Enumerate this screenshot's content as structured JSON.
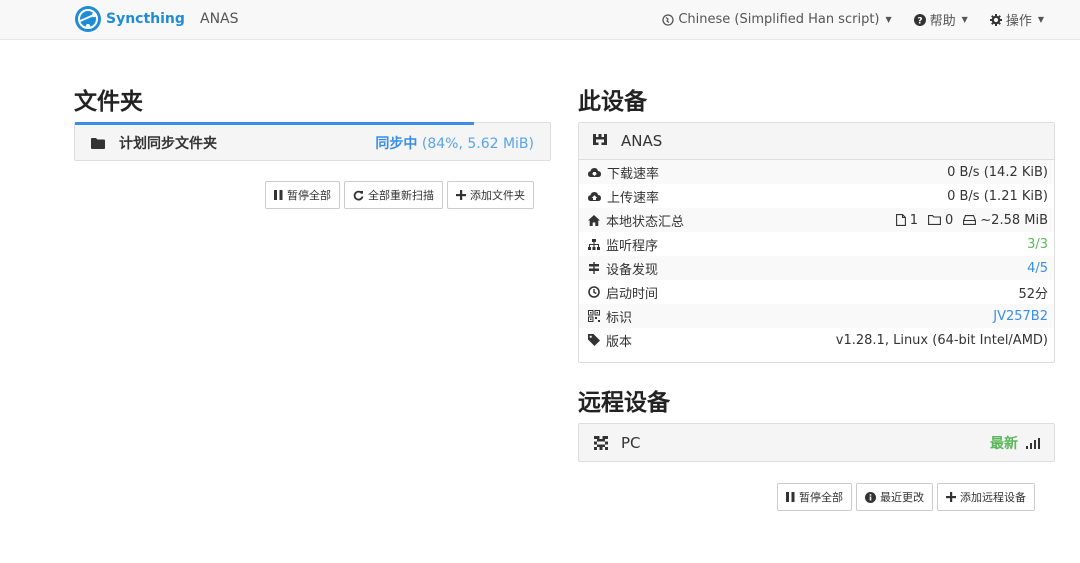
{
  "navbar": {
    "brand": "Syncthing",
    "device": "ANAS",
    "language": "Chinese (Simplified Han script)",
    "help": "帮助",
    "actions": "操作"
  },
  "folders": {
    "title": "文件夹",
    "items": [
      {
        "label": "计划同步文件夹",
        "status": "同步中",
        "detail": "(84%, 5.62 MiB)",
        "progress": 0.84
      }
    ],
    "buttons": {
      "pause_all": "暂停全部",
      "rescan_all": "全部重新扫描",
      "add_folder": "添加文件夹"
    }
  },
  "this_device": {
    "title": "此设备",
    "name": "ANAS",
    "rows": [
      {
        "label": "下载速率",
        "value": "0 B/s (14.2 KiB)"
      },
      {
        "label": "上传速率",
        "value": "0 B/s (1.21 KiB)"
      },
      {
        "label": "本地状态汇总",
        "files": "1",
        "dirs": "0",
        "size": "~2.58 MiB"
      },
      {
        "label": "监听程序",
        "value": "3/3"
      },
      {
        "label": "设备发现",
        "value": "4/5"
      },
      {
        "label": "启动时间",
        "value": "52分"
      },
      {
        "label": "标识",
        "value": "JV257B2"
      },
      {
        "label": "版本",
        "value": "v1.28.1, Linux (64-bit Intel/AMD)"
      }
    ]
  },
  "remote_devices": {
    "title": "远程设备",
    "items": [
      {
        "name": "PC",
        "status": "最新"
      }
    ],
    "buttons": {
      "pause_all": "暂停全部",
      "recent_changes": "最近更改",
      "add_remote": "添加远程设备"
    }
  },
  "colors": {
    "accent": "#3a8ee6",
    "success": "#5cb85c",
    "brand": "#1f8dd6"
  }
}
